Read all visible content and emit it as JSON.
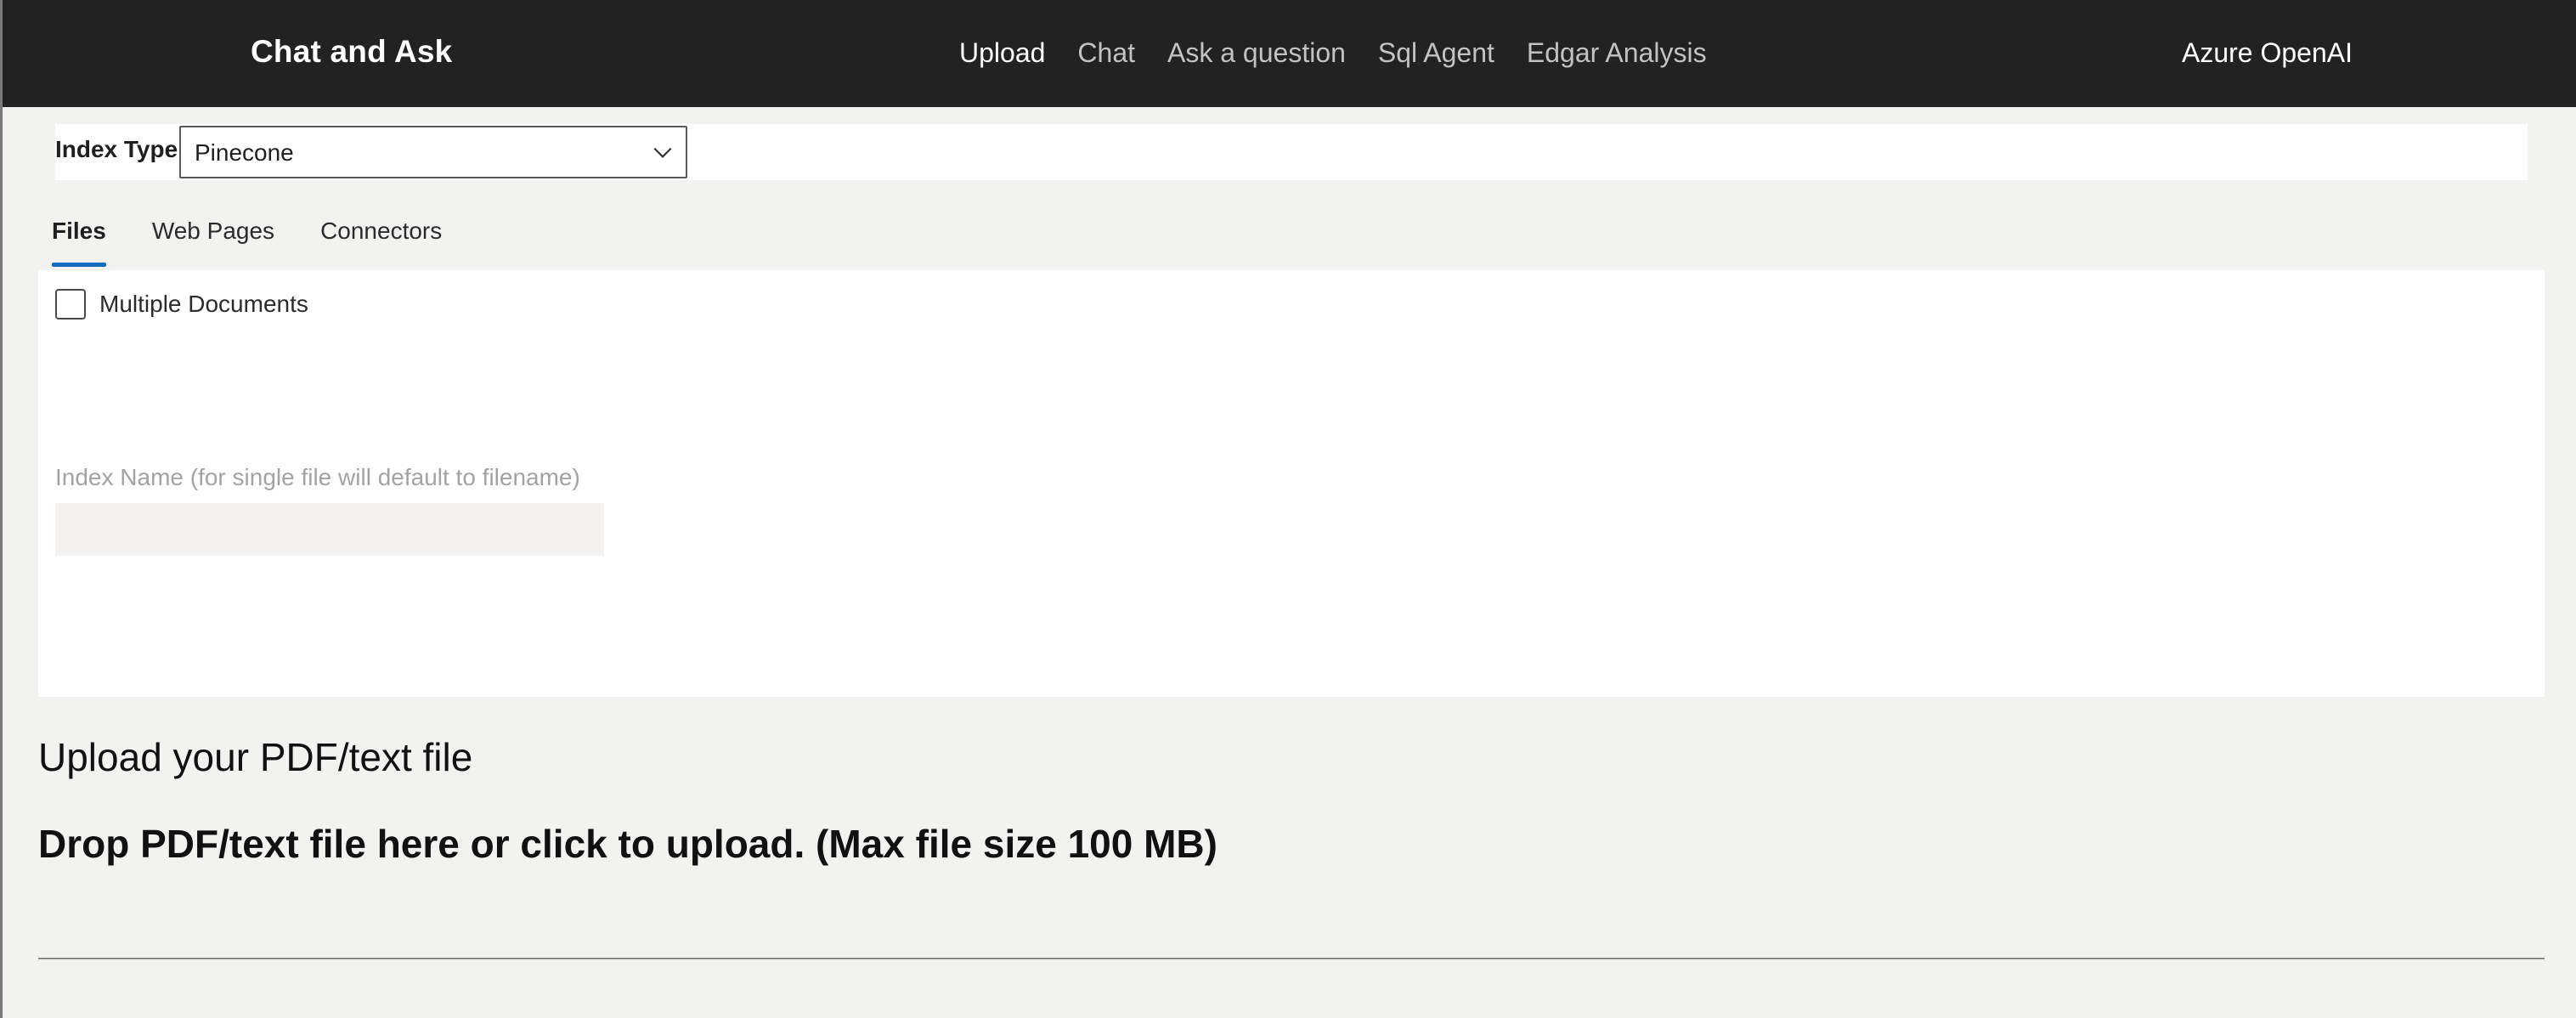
{
  "header": {
    "brand": "Chat and Ask",
    "nav": [
      {
        "label": "Upload",
        "active": true
      },
      {
        "label": "Chat",
        "active": false
      },
      {
        "label": "Ask a question",
        "active": false
      },
      {
        "label": "Sql Agent",
        "active": false
      },
      {
        "label": "Edgar Analysis",
        "active": false
      }
    ],
    "provider": "Azure OpenAI"
  },
  "index": {
    "label": "Index Type",
    "selected": "Pinecone",
    "icon": "chevron-down-icon"
  },
  "tabs": [
    {
      "label": "Files",
      "active": true
    },
    {
      "label": "Web Pages",
      "active": false
    },
    {
      "label": "Connectors",
      "active": false
    }
  ],
  "files": {
    "multiple_documents_label": "Multiple Documents",
    "multiple_documents_checked": false,
    "index_name_label": "Index Name (for single file will default to filename)",
    "index_name_value": ""
  },
  "upload": {
    "title": "Upload your PDF/text file",
    "drop_text": "Drop PDF/text file here or click to upload. (Max file size 100 MB)"
  },
  "colors": {
    "header_bg": "#222222",
    "accent": "#0f6cbd",
    "page_bg": "#f2f2f1"
  }
}
